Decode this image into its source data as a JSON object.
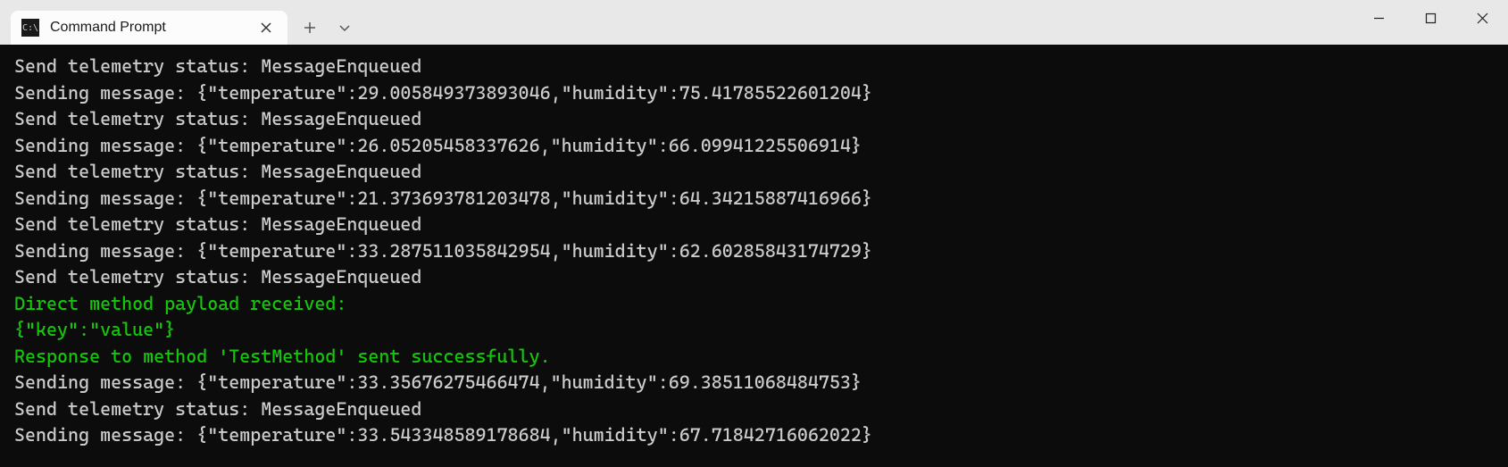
{
  "tab": {
    "title": "Command Prompt"
  },
  "terminal": {
    "lines": [
      {
        "text": "Send telemetry status: MessageEnqueued",
        "color": "default"
      },
      {
        "text": "Sending message: {\"temperature\":29.005849373893046,\"humidity\":75.41785522601204}",
        "color": "default"
      },
      {
        "text": "Send telemetry status: MessageEnqueued",
        "color": "default"
      },
      {
        "text": "Sending message: {\"temperature\":26.05205458337626,\"humidity\":66.09941225506914}",
        "color": "default"
      },
      {
        "text": "Send telemetry status: MessageEnqueued",
        "color": "default"
      },
      {
        "text": "Sending message: {\"temperature\":21.373693781203478,\"humidity\":64.34215887416966}",
        "color": "default"
      },
      {
        "text": "Send telemetry status: MessageEnqueued",
        "color": "default"
      },
      {
        "text": "Sending message: {\"temperature\":33.287511035842954,\"humidity\":62.60285843174729}",
        "color": "default"
      },
      {
        "text": "Send telemetry status: MessageEnqueued",
        "color": "default"
      },
      {
        "text": "Direct method payload received:",
        "color": "green"
      },
      {
        "text": "{\"key\":\"value\"}",
        "color": "green"
      },
      {
        "text": "Response to method 'TestMethod' sent successfully.",
        "color": "green"
      },
      {
        "text": "Sending message: {\"temperature\":33.35676275466474,\"humidity\":69.38511068484753}",
        "color": "default"
      },
      {
        "text": "Send telemetry status: MessageEnqueued",
        "color": "default"
      },
      {
        "text": "Sending message: {\"temperature\":33.543348589178684,\"humidity\":67.71842716062022}",
        "color": "default"
      }
    ]
  }
}
